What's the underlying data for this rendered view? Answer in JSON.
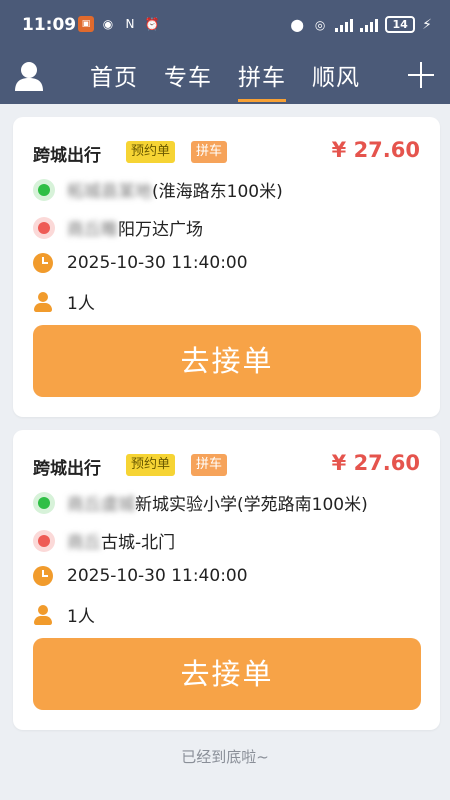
{
  "status_bar": {
    "time": "11:09",
    "battery": "14"
  },
  "nav": {
    "tabs": [
      {
        "label": "首页",
        "active": false
      },
      {
        "label": "专车",
        "active": false
      },
      {
        "label": "拼车",
        "active": true
      },
      {
        "label": "顺风",
        "active": false
      }
    ]
  },
  "orders": [
    {
      "title": "跨城出行",
      "tag_booking": "预约单",
      "tag_type": "拼车",
      "price": "¥ 27.60",
      "origin_blurred": "柘城县某地",
      "origin": "(淮海路东100米)",
      "destination_blurred": "商丘睢",
      "destination": "阳万达广场",
      "time": "2025-10-30 11:40:00",
      "passengers": "1人",
      "button_label": "去接单"
    },
    {
      "title": "跨城出行",
      "tag_booking": "预约单",
      "tag_type": "拼车",
      "price": "¥ 27.60",
      "origin_blurred": "商丘虞城",
      "origin": "新城实验小学(学苑路南100米)",
      "destination_blurred": "商丘",
      "destination": "古城-北门",
      "time": "2025-10-30 11:40:00",
      "passengers": "1人",
      "button_label": "去接单"
    }
  ],
  "footer": "已经到底啦~",
  "colors": {
    "header_bg": "#4b5a78",
    "accent": "#f7a347",
    "price": "#e5544d"
  }
}
